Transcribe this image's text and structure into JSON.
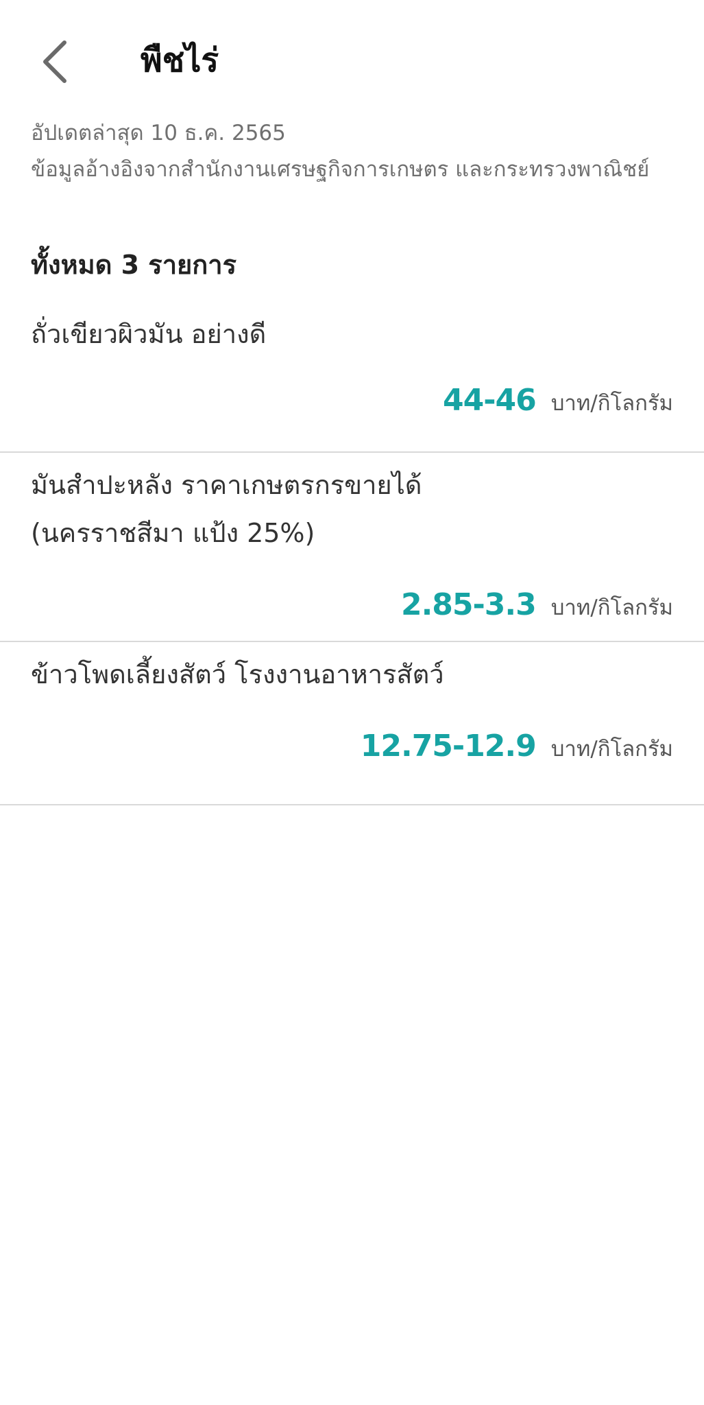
{
  "header": {
    "title": "พืชไร่",
    "back_icon": "chevron-left-icon"
  },
  "meta": {
    "updated": "อัปเดตล่าสุด 10 ธ.ค. 2565",
    "source": "ข้อมูลอ้างอิงจากสำนักงานเศรษฐกิจการเกษตร และกระทรวงพาณิชย์"
  },
  "summary": {
    "total": "ทั้งหมด 3 รายการ"
  },
  "items": [
    {
      "name": "ถั่วเขียวผิวมัน อย่างดี",
      "price": "44-46",
      "unit": "บาท/กิโลกรัม"
    },
    {
      "name": "มันสำปะหลัง ราคาเกษตรกรขายได้ (นครราชสีมา แป้ง 25%)",
      "price": "2.85-3.3",
      "unit": "บาท/กิโลกรัม"
    },
    {
      "name": "ข้าวโพดเลี้ยงสัตว์ โรงงานอาหารสัตว์",
      "price": "12.75-12.9",
      "unit": "บาท/กิโลกรัม"
    }
  ],
  "colors": {
    "price": "#17a3a3",
    "divider": "#d9d9d9"
  }
}
